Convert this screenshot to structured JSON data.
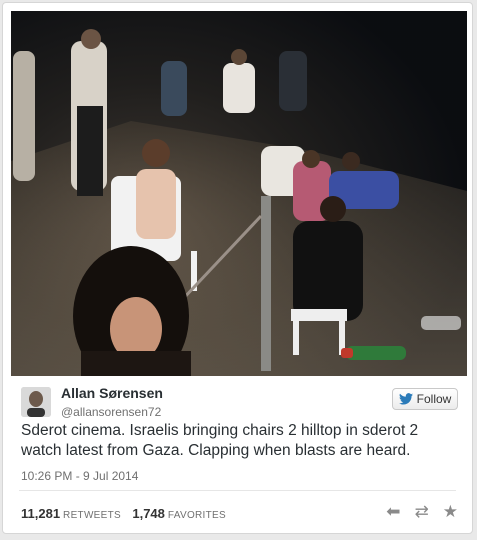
{
  "tweet": {
    "author_name": "Allan Sørensen",
    "author_handle": "@allansorensen72",
    "follow_label": "Follow",
    "text": "Sderot cinema. Israelis bringing chairs 2 hilltop in sderot 2 watch latest from Gaza. Clapping when blasts are heard.",
    "timestamp": "10:26 PM - 9 Jul 2014",
    "retweets_count": "11,281",
    "retweets_label": "RETWEETS",
    "favorites_count": "1,748",
    "favorites_label": "FAVORITES"
  },
  "icons": {
    "follow": "twitter-bird-icon",
    "reply": "reply-icon",
    "retweet": "retweet-icon",
    "favorite": "star-icon"
  },
  "colors": {
    "accent": "#2b7bb9",
    "text": "#292f33",
    "muted": "#707070"
  }
}
